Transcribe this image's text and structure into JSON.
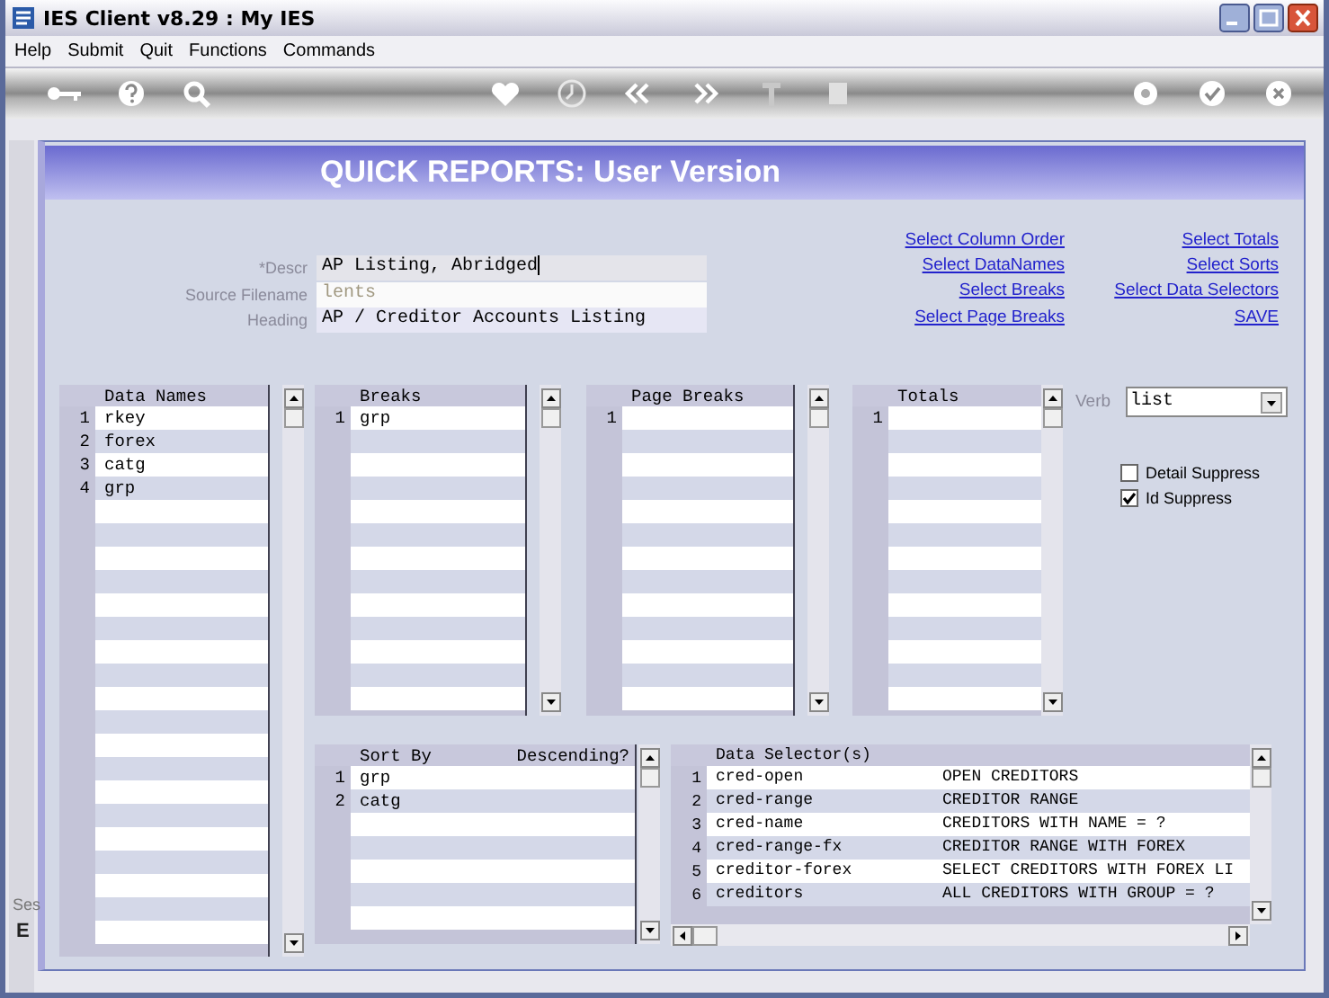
{
  "window": {
    "title": "IES Client v8.29 : My IES"
  },
  "menu": [
    "Help",
    "Submit",
    "Quit",
    "Functions",
    "Commands"
  ],
  "header": {
    "title": "QUICK REPORTS: User Version"
  },
  "form": [
    {
      "label": "*Descr",
      "value": "AP Listing, Abridged",
      "disabled": false
    },
    {
      "label": "Source Filename",
      "value": "lents",
      "disabled": true
    },
    {
      "label": "Heading",
      "value": "AP / Creditor Accounts Listing",
      "disabled": false
    }
  ],
  "links_left": [
    "Select Column Order",
    "Select DataNames",
    "Select Breaks",
    "Select Page Breaks"
  ],
  "links_right": [
    "Select Totals",
    "Select Sorts",
    "Select Data Selectors",
    "SAVE"
  ],
  "data_names": {
    "header": "Data Names",
    "rows": [
      {
        "num": "1",
        "value": "rkey"
      },
      {
        "num": "2",
        "value": "forex"
      },
      {
        "num": "3",
        "value": "catg"
      },
      {
        "num": "4",
        "value": "grp"
      }
    ]
  },
  "breaks": {
    "header": "Breaks",
    "rows": [
      {
        "num": "1",
        "value": "grp"
      }
    ]
  },
  "page_breaks": {
    "header": "Page Breaks",
    "rows": [
      {
        "num": "1"
      }
    ]
  },
  "totals": {
    "header": "Totals",
    "rows": [
      {
        "num": "1"
      }
    ]
  },
  "verb": {
    "label": "Verb",
    "value": "list"
  },
  "checkboxes": [
    {
      "label": "Detail Suppress",
      "checked": false
    },
    {
      "label": "Id Suppress",
      "checked": true
    }
  ],
  "sort_by": {
    "header": "Sort By",
    "column_2": "Descending?",
    "rows": [
      {
        "num": "1",
        "value": "grp"
      },
      {
        "num": "2",
        "value": "catg"
      }
    ]
  },
  "data_selectors": {
    "header": "Data Selector(s)",
    "rows": [
      {
        "num": "1",
        "value": "cred-open",
        "description": "OPEN CREDITORS"
      },
      {
        "num": "2",
        "value": "cred-range",
        "description": "CREDITOR RANGE"
      },
      {
        "num": "3",
        "value": "cred-name",
        "description": "CREDITORS WITH NAME = ?"
      },
      {
        "num": "4",
        "value": "cred-range-fx",
        "description": "CREDITOR RANGE WITH FOREX"
      },
      {
        "num": "5",
        "value": "creditor-forex",
        "description": "SELECT CREDITORS WITH FOREX LI"
      },
      {
        "num": "6",
        "value": "creditors",
        "description": "ALL CREDITORS WITH GROUP = ?"
      }
    ]
  },
  "background_window": [
    "Ses",
    "E"
  ]
}
